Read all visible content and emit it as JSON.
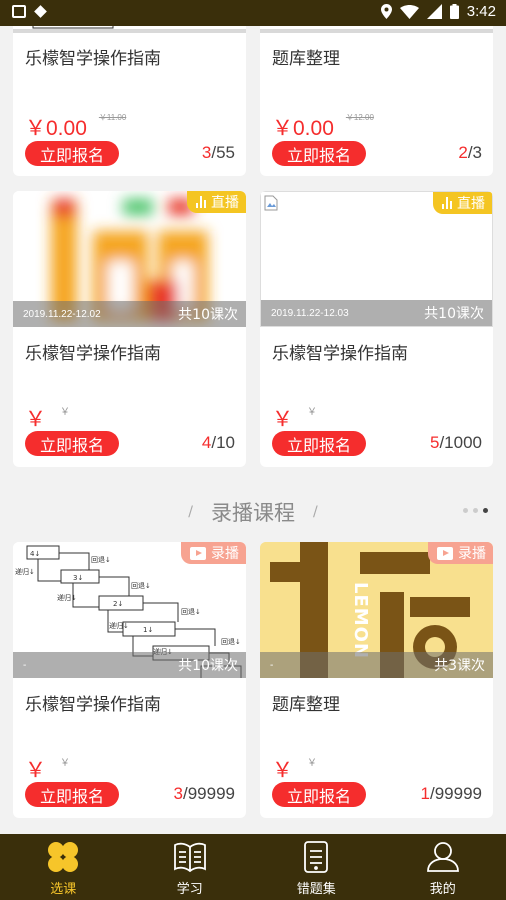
{
  "status_bar": {
    "time": "3:42"
  },
  "cards": [
    {
      "title": "乐檬智学操作指南",
      "price": "￥0.00",
      "original_price": "￥11.00",
      "enroll_label": "立即报名",
      "enrolled": "3",
      "capacity": "/55"
    },
    {
      "title": "题库整理",
      "price": "￥0.00",
      "original_price": "￥12.00",
      "enroll_label": "立即报名",
      "enrolled": "2",
      "capacity": "/3"
    },
    {
      "badge": "直播",
      "date": "2019.11.22-12.02",
      "lessons": "共10课次",
      "title": "乐檬智学操作指南",
      "price": "￥",
      "original_price": "￥",
      "enroll_label": "立即报名",
      "enrolled": "4",
      "capacity": "/10"
    },
    {
      "badge": "直播",
      "date": "2019.11.22-12.03",
      "lessons": "共10课次",
      "title": "乐檬智学操作指南",
      "price": "￥",
      "original_price": "￥",
      "enroll_label": "立即报名",
      "enrolled": "5",
      "capacity": "/1000"
    },
    {
      "badge": "录播",
      "date": "-",
      "lessons": "共10课次",
      "title": "乐檬智学操作指南",
      "price": "￥",
      "original_price": "￥",
      "enroll_label": "立即报名",
      "enrolled": "3",
      "capacity": "/99999"
    },
    {
      "badge": "录播",
      "date": "-",
      "lessons": "共3课次",
      "title": "题库整理",
      "price": "￥",
      "original_price": "￥",
      "enroll_label": "立即报名",
      "enrolled": "1",
      "capacity": "/99999"
    }
  ],
  "section": {
    "title": "录播课程",
    "slash": "/"
  },
  "thumb_text": {
    "lemon": "LEMON",
    "flow": [
      "4↓",
      "3↓",
      "2↓",
      "1↓",
      "回退↓",
      "回退↓",
      "回退↓",
      "递归↓",
      "递归↓",
      "递归↓",
      "递归↓",
      "回退↓"
    ]
  },
  "tabbar": [
    {
      "label": "选课",
      "icon": "course-select-icon",
      "active": true
    },
    {
      "label": "学习",
      "icon": "book-icon",
      "active": false
    },
    {
      "label": "错题集",
      "icon": "mistakes-icon",
      "active": false
    },
    {
      "label": "我的",
      "icon": "profile-icon",
      "active": false
    }
  ],
  "colors": {
    "accent_red": "#f52d2d",
    "tab_bg": "#3a2f0b",
    "tab_active": "#f6c52a",
    "live_badge": "#f4c522",
    "rec_badge": "#f7a391"
  }
}
